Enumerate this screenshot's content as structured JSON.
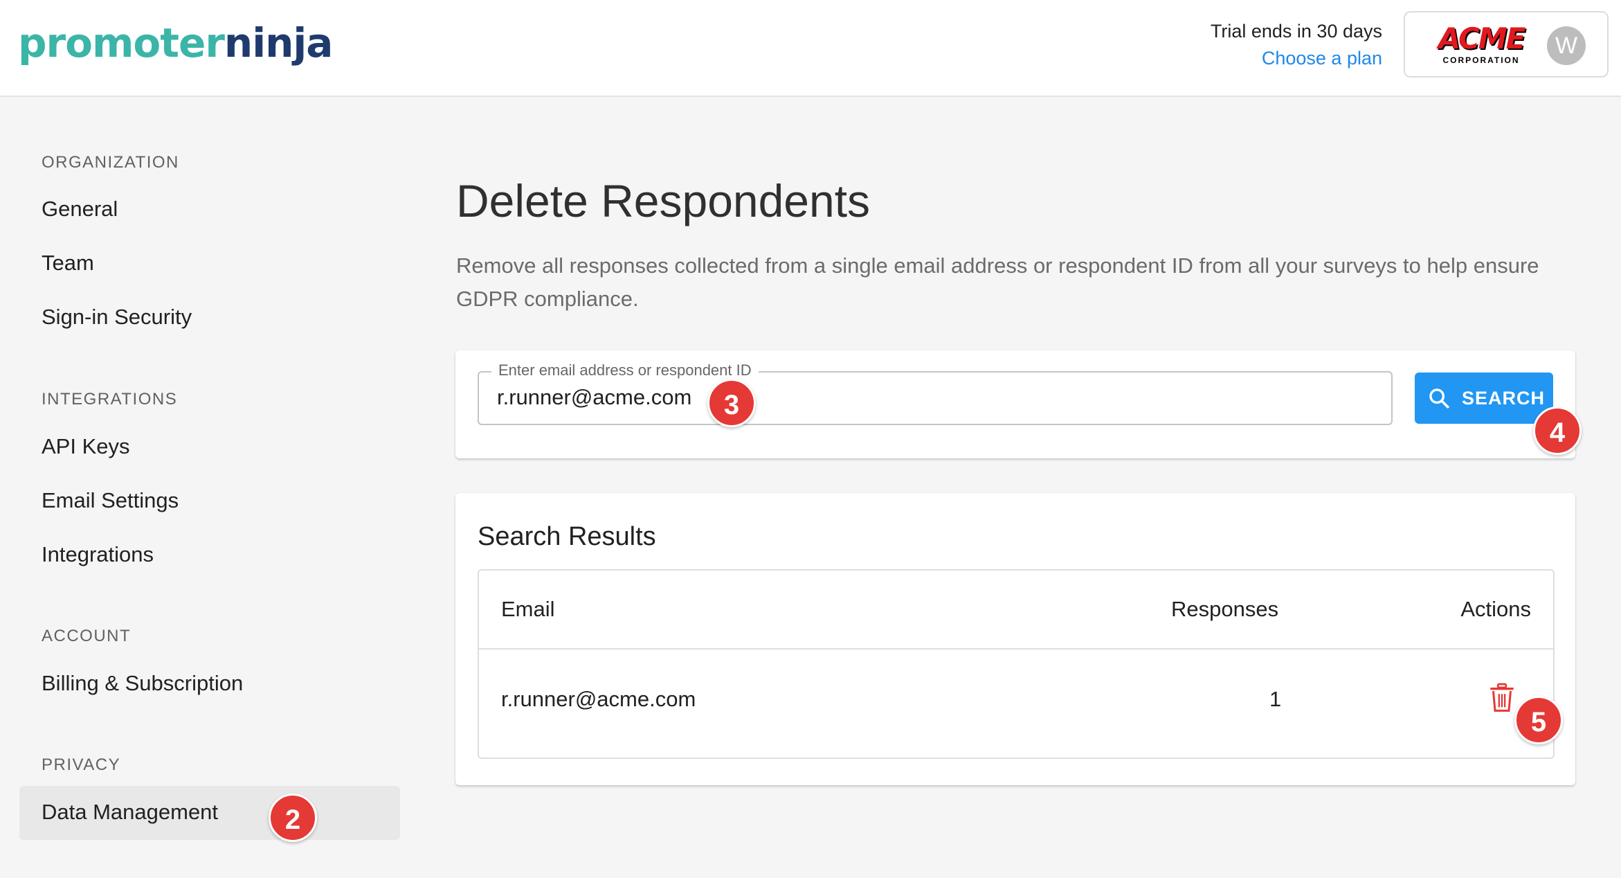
{
  "header": {
    "logo_part1": "promoter",
    "logo_part2": "ninja",
    "trial_text": "Trial ends in 30 days",
    "choose_plan": "Choose a plan",
    "account_logo_main": "ACME",
    "account_logo_sub": "CORPORATION",
    "avatar_initial": "W"
  },
  "sidebar": {
    "sections": [
      {
        "heading": "ORGANIZATION",
        "items": [
          "General",
          "Team",
          "Sign-in Security"
        ]
      },
      {
        "heading": "INTEGRATIONS",
        "items": [
          "API Keys",
          "Email Settings",
          "Integrations"
        ]
      },
      {
        "heading": "ACCOUNT",
        "items": [
          "Billing & Subscription"
        ]
      },
      {
        "heading": "PRIVACY",
        "items": [
          "Data Management"
        ]
      }
    ],
    "active_item": "Data Management"
  },
  "main": {
    "title": "Delete Respondents",
    "description": "Remove all responses collected from a single email address or respondent ID from all your surveys to help ensure GDPR compliance.",
    "search": {
      "label": "Enter email address or respondent ID",
      "value": "r.runner@acme.com",
      "button_label": "SEARCH"
    },
    "results": {
      "title": "Search Results",
      "columns": [
        "Email",
        "Responses",
        "Actions"
      ],
      "rows": [
        {
          "email": "r.runner@acme.com",
          "responses": "1"
        }
      ]
    }
  },
  "annotations": [
    "2",
    "3",
    "4",
    "5"
  ],
  "colors": {
    "accent": "#2196f3",
    "link": "#1e88e5",
    "danger": "#e53935",
    "logo_teal": "#3bb5a7",
    "logo_navy": "#1f3b6e"
  }
}
